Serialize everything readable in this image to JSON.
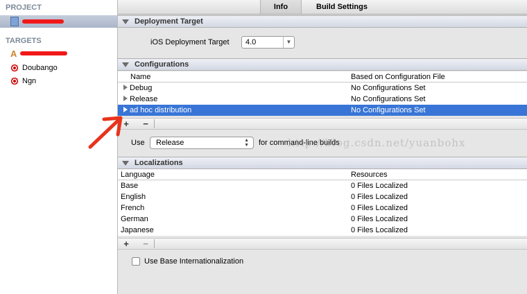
{
  "sidebar": {
    "project_header": "PROJECT",
    "targets_header": "TARGETS",
    "targets": [
      {
        "label": "Doubango"
      },
      {
        "label": "Ngn"
      }
    ]
  },
  "tabs": {
    "info": "Info",
    "build_settings": "Build Settings"
  },
  "deployment": {
    "title": "Deployment Target",
    "label": "iOS Deployment Target",
    "value": "4.0"
  },
  "configurations": {
    "title": "Configurations",
    "columns": [
      "Name",
      "Based on Configuration File"
    ],
    "rows": [
      {
        "name": "Debug",
        "file": "No Configurations Set"
      },
      {
        "name": "Release",
        "file": "No Configurations Set"
      },
      {
        "name": "ad hoc distribution",
        "file": "No Configurations Set"
      }
    ],
    "add": "+",
    "remove": "−",
    "use_label": "Use",
    "use_value": "Release",
    "use_suffix": "for command-line builds"
  },
  "watermark": "http://blog.csdn.net/yuanbohx",
  "localizations": {
    "title": "Localizations",
    "columns": [
      "Language",
      "Resources"
    ],
    "rows": [
      {
        "lang": "Base",
        "res": "0 Files Localized"
      },
      {
        "lang": "English",
        "res": "0 Files Localized"
      },
      {
        "lang": "French",
        "res": "0 Files Localized"
      },
      {
        "lang": "German",
        "res": "0 Files Localized"
      },
      {
        "lang": "Japanese",
        "res": "0 Files Localized"
      }
    ],
    "add": "+",
    "remove": "−",
    "base_intl": "Use Base Internationalization"
  }
}
